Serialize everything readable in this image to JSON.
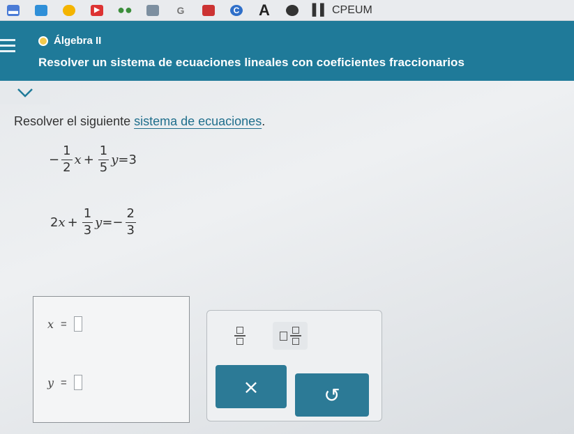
{
  "browser": {
    "bookmark_label": "CPEUM",
    "icons": [
      "mail-icon",
      "drive-icon",
      "folder-icon",
      "youtube-icon",
      "apps-icon",
      "image-icon",
      "google-icon",
      "video-icon",
      "chrome-icon",
      "font-icon",
      "sync-icon",
      "bookmark-icon"
    ]
  },
  "header": {
    "course": "Álgebra II",
    "topic": "Resolver un sistema de ecuaciones lineales con coeficientes fraccionarios",
    "colors": {
      "bar": "#1f7a99",
      "course_dot": "#f2c94c"
    }
  },
  "problem": {
    "prompt_before": "Resolver el siguiente ",
    "prompt_link": "sistema de ecuaciones",
    "prompt_after": ".",
    "eq1": {
      "sign1": "−",
      "a_num": "1",
      "a_den": "2",
      "x": "x",
      "plus": "+",
      "b_num": "1",
      "b_den": "5",
      "y": "y",
      "eq": "=",
      "rhs": "3"
    },
    "eq2": {
      "coef": "2",
      "x": "x",
      "plus": "+",
      "b_num": "1",
      "b_den": "3",
      "y": "y",
      "eq": "=",
      "sign": "−",
      "r_num": "2",
      "r_den": "3"
    }
  },
  "answer": {
    "x_label": "x",
    "y_label": "y",
    "equals": "=",
    "x_value": "",
    "y_value": ""
  },
  "keypad": {
    "clear_symbol": "×",
    "undo_symbol": "↺",
    "button_color": "#2c7a96"
  }
}
